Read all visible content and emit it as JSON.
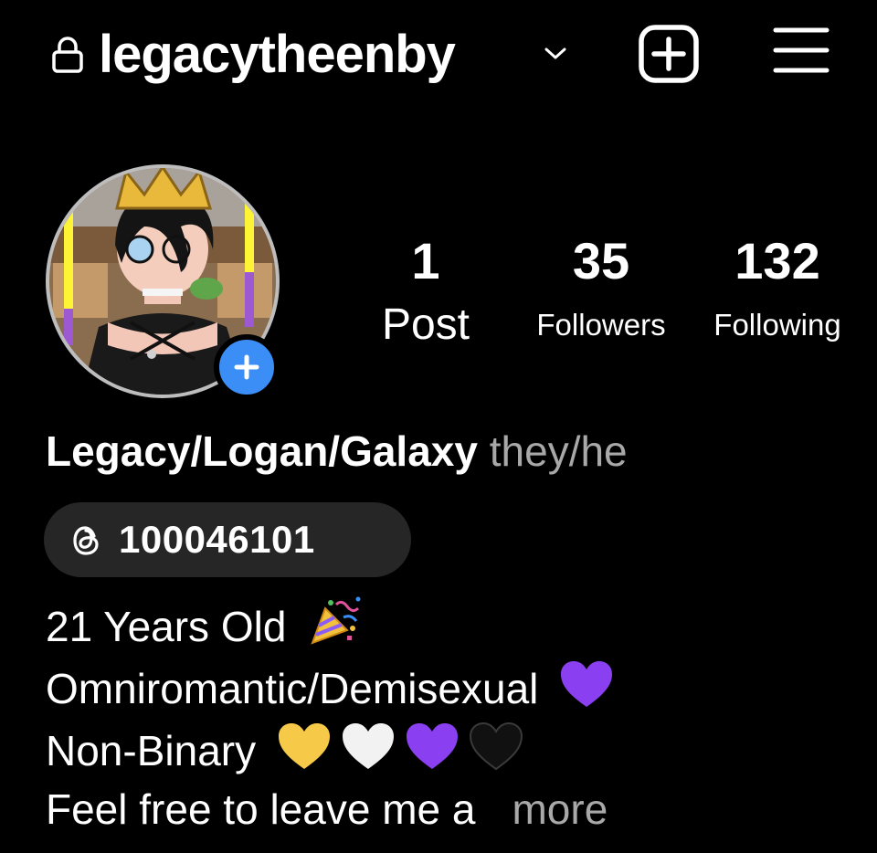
{
  "header": {
    "lock_icon": "lock-icon",
    "username": "legacytheenby",
    "account_switcher_icon": "chevron-down-icon",
    "create_icon": "plus-square-icon",
    "menu_icon": "hamburger-menu-icon"
  },
  "profile": {
    "avatar_alt": "profile picture",
    "add_story_icon": "plus-icon",
    "stats": {
      "posts": {
        "count": "1",
        "label": "Post"
      },
      "followers": {
        "count": "35",
        "label": "Followers"
      },
      "following": {
        "count": "132",
        "label": "Following"
      }
    },
    "display_name": "Legacy/Logan/Galaxy",
    "pronouns": "they/he",
    "threads": {
      "icon": "threads-icon",
      "id": "100046101"
    },
    "bio": {
      "line1": "21 Years Old",
      "line2": "Omniromantic/Demisexual",
      "line3": "Non-Binary",
      "line4": "Feel free to leave me a",
      "more_label": "more"
    }
  },
  "colors": {
    "background": "#000000",
    "text": "#ffffff",
    "secondary_text": "#a8a8a8",
    "badge_bg": "#262626",
    "accent_blue": "#3a8ef5",
    "heart_purple": "#8a3ff0",
    "heart_yellow": "#f7c948",
    "heart_white": "#f2f2f2",
    "heart_black": "#111111"
  }
}
